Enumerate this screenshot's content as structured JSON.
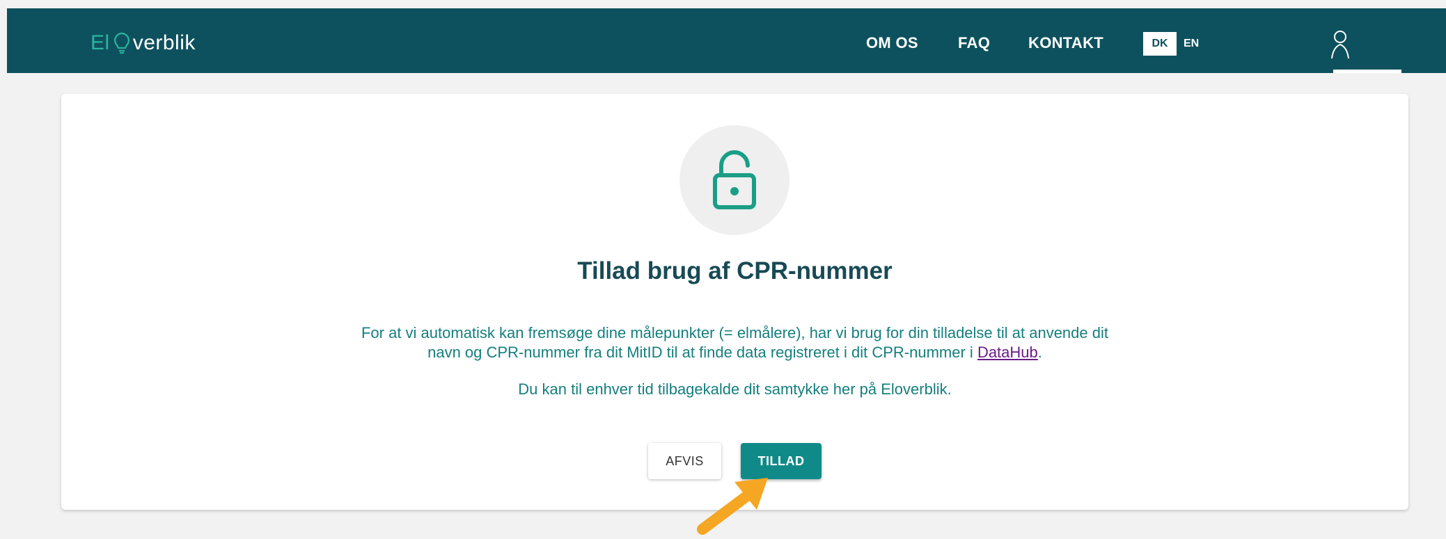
{
  "header": {
    "logo_prefix": "El",
    "logo_suffix": "verblik",
    "nav": {
      "om_os": "OM OS",
      "faq": "FAQ",
      "kontakt": "KONTAKT"
    },
    "languages": {
      "dk": "DK",
      "en": "EN",
      "selected": "DK"
    },
    "user_icon": "user-icon"
  },
  "dialog": {
    "icon": "unlock-icon",
    "title": "Tillad brug af CPR-nummer",
    "description_part1": "For at vi automatisk kan fremsøge dine målepunkter (= elmålere), har vi brug for din tilladelse til at anvende dit",
    "description_part2": "navn og CPR-nummer fra dit MitID til at finde data registreret i dit CPR-nummer i",
    "datahub_link": "DataHub",
    "description_end": ".",
    "note": "Du kan til enhver tid tilbagekalde dit samtykke her på Eloverblik.",
    "buttons": {
      "reject": "AFVIS",
      "accept": "TILLAD"
    }
  },
  "colors": {
    "header_bg": "#0e515e",
    "accent": "#0f8a88",
    "text_teal": "#157e7e",
    "annotation_arrow": "#f5a623"
  }
}
